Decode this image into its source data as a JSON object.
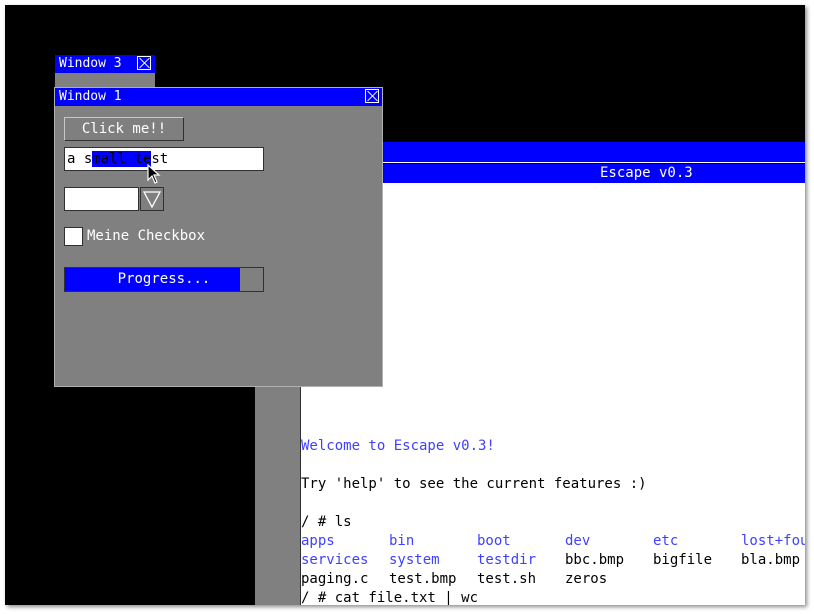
{
  "window3": {
    "title": "Window 3"
  },
  "window1": {
    "title": "Window 1",
    "button_label": "Click me!!",
    "textfield": {
      "before": "a s",
      "selected": "mall te",
      "after": "st"
    },
    "combo_value": "",
    "checkbox_label": "Meine Checkbox",
    "checkbox_checked": false,
    "progress": {
      "label": "Progress...",
      "value": 0.885
    }
  },
  "terminal": {
    "title": "Escape v0.3",
    "welcome": "Welcome to Escape v0.3!",
    "help": "Try 'help' to see the current features :)",
    "prompt1": "/ # ls",
    "ls_rows": [
      [
        {
          "name": "apps",
          "dir": true
        },
        {
          "name": "bin",
          "dir": true
        },
        {
          "name": "boot",
          "dir": true
        },
        {
          "name": "dev",
          "dir": true
        },
        {
          "name": "etc",
          "dir": true
        },
        {
          "name": "lost+fou",
          "dir": true
        }
      ],
      [
        {
          "name": "services",
          "dir": true
        },
        {
          "name": "system",
          "dir": true
        },
        {
          "name": "testdir",
          "dir": true
        },
        {
          "name": "bbc.bmp",
          "dir": false
        },
        {
          "name": "bigfile",
          "dir": false
        },
        {
          "name": "bla.bmp",
          "dir": false
        }
      ],
      [
        {
          "name": "paging.c",
          "dir": false
        },
        {
          "name": "test.bmp",
          "dir": false
        },
        {
          "name": "test.sh",
          "dir": false
        },
        {
          "name": "zeros",
          "dir": false
        }
      ]
    ],
    "prompt2": "/ # cat file.txt | wc"
  },
  "colors": {
    "accent": "#0000ff",
    "dir_text": "#4040ff",
    "window_bg": "#808080",
    "desktop": "#000000"
  },
  "icons": {
    "close": "close-icon",
    "dropdown": "chevron-down-icon",
    "cursor": "mouse-cursor-icon"
  }
}
